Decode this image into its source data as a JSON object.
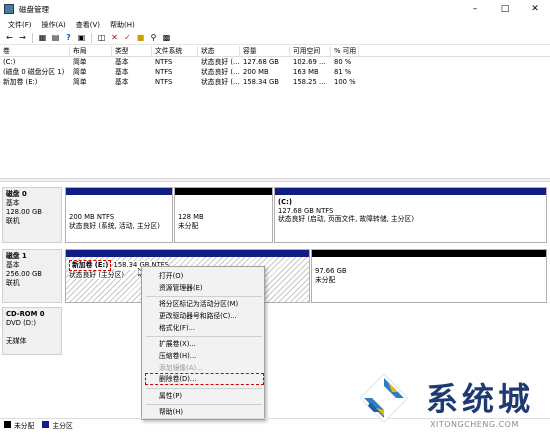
{
  "window": {
    "title": "磁盘管理"
  },
  "menu": [
    "文件(F)",
    "操作(A)",
    "查看(V)",
    "帮助(H)"
  ],
  "volume_table": {
    "columns": [
      "卷",
      "布局",
      "类型",
      "文件系统",
      "状态",
      "容量",
      "可用空间",
      "% 可用"
    ],
    "rows": [
      [
        "(C:)",
        "简单",
        "基本",
        "NTFS",
        "状态良好 (...",
        "127.68 GB",
        "102.69 ...",
        "80 %"
      ],
      [
        "(磁盘 0 磁盘分区 1)",
        "简单",
        "基本",
        "NTFS",
        "状态良好 (...",
        "200 MB",
        "163 MB",
        "81 %"
      ],
      [
        "新加卷 (E:)",
        "简单",
        "基本",
        "NTFS",
        "状态良好 (...",
        "158.34 GB",
        "158.25 ...",
        "100 %"
      ]
    ]
  },
  "disks": [
    {
      "name": "磁盘 0",
      "type": "基本",
      "size": "128.00 GB",
      "status": "联机",
      "partitions": [
        {
          "line1": "200 MB NTFS",
          "line2": "状态良好 (系统, 活动, 主分区)"
        },
        {
          "line1": "128 MB",
          "line2": "未分配"
        },
        {
          "title": "(C:)",
          "line1": "127.68 GB NTFS",
          "line2": "状态良好 (启动, 页面文件, 故障转储, 主分区)"
        }
      ]
    },
    {
      "name": "磁盘 1",
      "type": "基本",
      "size": "256.00 GB",
      "status": "联机",
      "partitions": [
        {
          "title": "新加卷 (E:)",
          "line1": "158.34 GB NTFS",
          "line2": "状态良好 (主分区)"
        },
        {
          "line1": "97.66 GB",
          "line2": "未分配"
        }
      ]
    },
    {
      "name": "CD-ROM 0",
      "type": "DVD (D:)",
      "status": "无媒体"
    }
  ],
  "context_menu": {
    "items": [
      {
        "label": "打开(O)",
        "enabled": true
      },
      {
        "label": "资源管理器(E)",
        "enabled": true
      },
      {
        "label": "将分区标记为活动分区(M)",
        "enabled": true
      },
      {
        "label": "更改驱动器号和路径(C)...",
        "enabled": true
      },
      {
        "label": "格式化(F)...",
        "enabled": true
      },
      {
        "label": "扩展卷(X)...",
        "enabled": true
      },
      {
        "label": "压缩卷(H)...",
        "enabled": true
      },
      {
        "label": "添加镜像(A)...",
        "enabled": false
      },
      {
        "label": "删除卷(D)...",
        "enabled": true,
        "highlighted": true
      },
      {
        "label": "属性(P)",
        "enabled": true
      },
      {
        "label": "帮助(H)",
        "enabled": true
      }
    ]
  },
  "legend": [
    {
      "label": "未分配",
      "color": "#000000"
    },
    {
      "label": "主分区",
      "color": "#101d84"
    }
  ],
  "watermark": {
    "text": "系统城",
    "url": "XITONGCHENG.COM"
  },
  "colors": {
    "primary_partition": "#101d84",
    "unallocated": "#000000",
    "highlight": "#d00000"
  }
}
